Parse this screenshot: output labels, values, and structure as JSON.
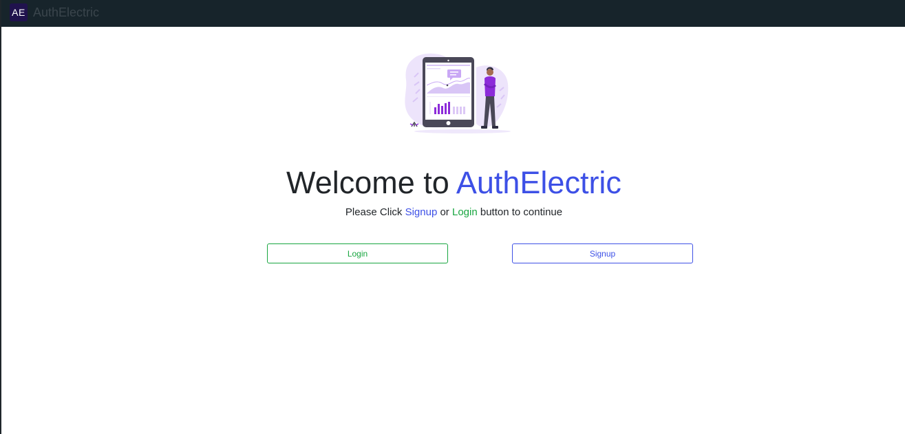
{
  "navbar": {
    "logo_text": "AE",
    "brand_name": "AuthElectric"
  },
  "hero": {
    "illustration": "dashboard-tablet-person-illustration"
  },
  "heading": {
    "prefix": "Welcome to ",
    "brand": "AuthElectric"
  },
  "subtitle": {
    "part1": "Please Click ",
    "signup_word": "Signup",
    "part2": " or ",
    "login_word": "Login",
    "part3": " button to continue"
  },
  "buttons": {
    "login_label": "Login",
    "signup_label": "Signup"
  },
  "colors": {
    "navbar_bg": "#17242b",
    "accent_blue": "#3d50e6",
    "accent_green": "#17a53f",
    "illustration_purple": "#8c2bd9"
  }
}
